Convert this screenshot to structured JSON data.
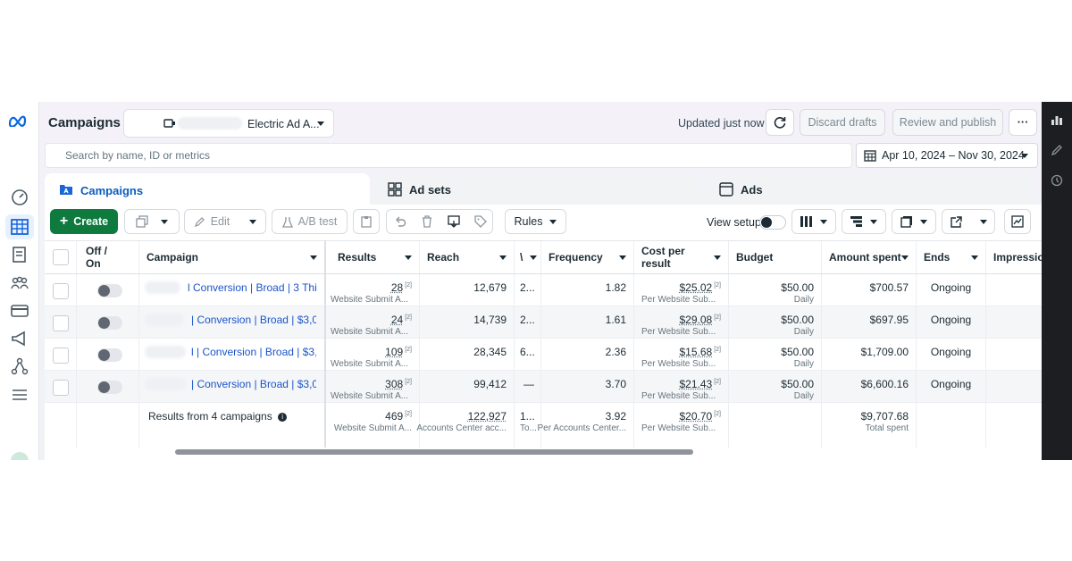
{
  "header": {
    "title": "Campaigns",
    "account_name": "Electric Ad A...",
    "updated": "Updated just now",
    "discard": "Discard drafts",
    "review": "Review and publish",
    "more": "···"
  },
  "search": {
    "placeholder": "Search by name, ID or metrics"
  },
  "date_range": "Apr 10, 2024 – Nov 30, 2024",
  "tabs": [
    {
      "label": "Campaigns"
    },
    {
      "label": "Ad sets"
    },
    {
      "label": "Ads"
    }
  ],
  "toolbar": {
    "create": "Create",
    "edit": "Edit",
    "ab_test": "A/B test",
    "rules": "Rules",
    "view_setup": "View setup"
  },
  "columns": {
    "off_on": "Off / On",
    "campaign": "Campaign",
    "results": "Results",
    "reach": "Reach",
    "truncated": "\\",
    "frequency": "Frequency",
    "cost_per_result": "Cost per result",
    "budget": "Budget",
    "amount_spent": "Amount spent",
    "ends": "Ends",
    "impressions": "Impressio"
  },
  "rows": [
    {
      "name": "l Conversion | Broad | 3 Thin...",
      "results": "28",
      "results_sub": "Website Submit A...",
      "reach": "12,679",
      "col_x": "2...",
      "frequency": "1.82",
      "cost": "$25.02",
      "cost_sub": "Per Website Sub...",
      "budget": "$50.00",
      "budget_sub": "Daily",
      "spent": "$700.57",
      "ends": "Ongoing"
    },
    {
      "name": "| Conversion | Broad | $3,0...",
      "results": "24",
      "results_sub": "Website Submit A...",
      "reach": "14,739",
      "col_x": "2...",
      "frequency": "1.61",
      "cost": "$29.08",
      "cost_sub": "Per Website Sub...",
      "budget": "$50.00",
      "budget_sub": "Daily",
      "spent": "$697.95",
      "ends": "Ongoing"
    },
    {
      "name": "l | Conversion | Broad | $3,0...",
      "results": "109",
      "results_sub": "Website Submit A...",
      "reach": "28,345",
      "col_x": "6...",
      "frequency": "2.36",
      "cost": "$15.68",
      "cost_sub": "Per Website Sub...",
      "budget": "$50.00",
      "budget_sub": "Daily",
      "spent": "$1,709.00",
      "ends": "Ongoing"
    },
    {
      "name": "| Conversion | Broad | $3,0...",
      "results": "308",
      "results_sub": "Website Submit A...",
      "reach": "99,412",
      "col_x": "—",
      "frequency": "3.70",
      "cost": "$21.43",
      "cost_sub": "Per Website Sub...",
      "budget": "$50.00",
      "budget_sub": "Daily",
      "spent": "$6,600.16",
      "ends": "Ongoing"
    }
  ],
  "totals": {
    "label": "Results from 4 campaigns",
    "results": "469",
    "results_sub": "Website Submit A...",
    "reach": "122,927",
    "reach_sub": "Accounts Center acc...",
    "col_x": "1...",
    "col_x_sub": "To...",
    "frequency": "3.92",
    "frequency_sub": "Per Accounts Center...",
    "cost": "$20.70",
    "cost_sub": "Per Website Sub...",
    "spent": "$9,707.68",
    "spent_sub": "Total spent"
  },
  "footnote_marker": "[2]",
  "colors": {
    "brand_green": "#0e7a3e",
    "link_blue": "#1a55c9",
    "active_tab": "#0a5cc2"
  }
}
